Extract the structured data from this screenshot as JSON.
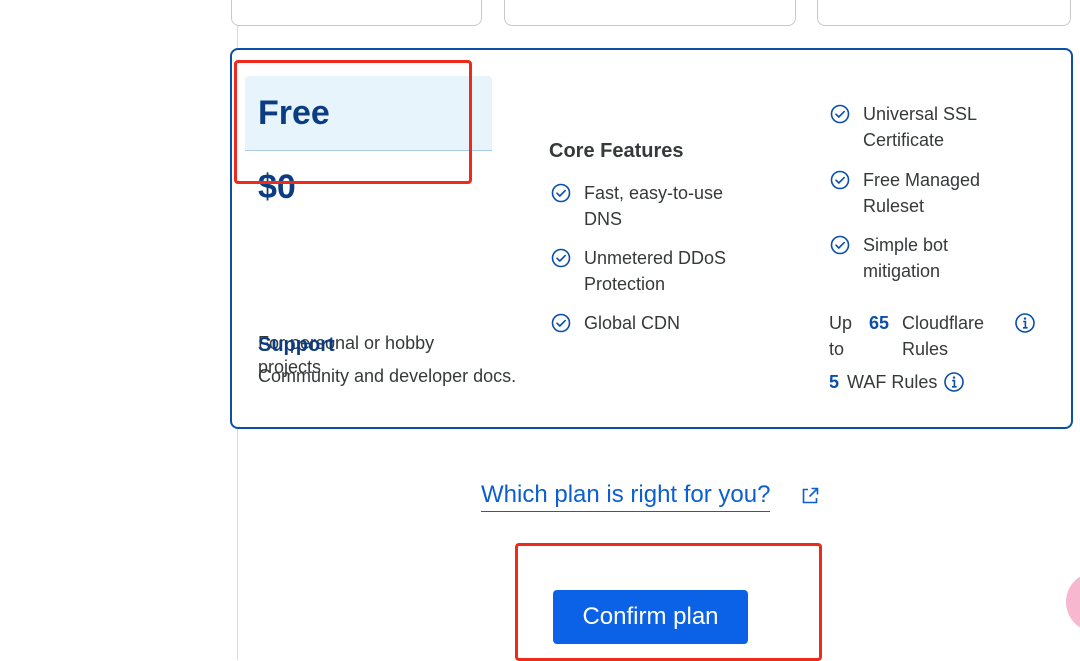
{
  "plan": {
    "name": "Free",
    "price": "$0",
    "description": "For personal or hobby projects",
    "support_title": "Support",
    "support_text": "Community and developer docs."
  },
  "features": {
    "title": "Core Features",
    "col1": [
      {
        "label": "Fast, easy-to-use DNS",
        "icon": "check-circle-icon"
      },
      {
        "label": "Unmetered DDoS Protection",
        "icon": "check-circle-icon"
      },
      {
        "label": "Global CDN",
        "icon": "check-circle-icon"
      }
    ],
    "col2": [
      {
        "label": "Universal SSL Certificate",
        "icon": "check-circle-icon"
      },
      {
        "label": "Free Managed Ruleset",
        "icon": "check-circle-icon"
      },
      {
        "label": "Simple bot mitigation",
        "icon": "check-circle-icon"
      }
    ]
  },
  "limits": {
    "rules_prefix": "Up to",
    "rules_count": "65",
    "rules_label": "Cloudflare Rules",
    "waf_count": "5",
    "waf_label": "WAF Rules",
    "icon": "info-icon"
  },
  "link": {
    "label": "Which plan is right for you?",
    "icon": "external-link-icon"
  },
  "confirm": {
    "label": "Confirm plan"
  },
  "colors": {
    "accent": "#0b62e6",
    "card_border": "#0b4fa8",
    "heading": "#0b3d80",
    "annotation": "#ee2a1b"
  }
}
